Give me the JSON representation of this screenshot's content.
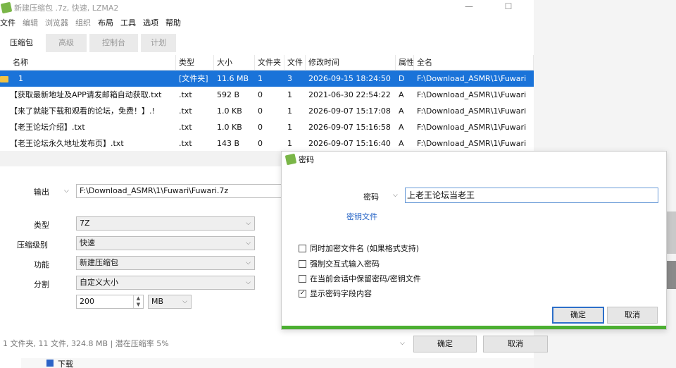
{
  "window": {
    "title": "新建压缩包 .7z, 快速, LZMA2",
    "minimize": "—",
    "maximize": "☐"
  },
  "menu": [
    "文件",
    "编辑",
    "浏览器",
    "组织",
    "布局",
    "工具",
    "选项",
    "帮助"
  ],
  "tabs": [
    "压缩包",
    "高级",
    "控制台",
    "计划"
  ],
  "table": {
    "headers": [
      "名称",
      "类型",
      "大小",
      "文件夹",
      "文件",
      "修改时间",
      "属性",
      "全名"
    ],
    "rows": [
      {
        "name": "1",
        "type": "[文件夹]",
        "size": "11.6 MB",
        "folders": "1",
        "files": "3",
        "modified": "2026-09-15 18:24:50",
        "attr": "D",
        "fullname": "F:\\Download_ASMR\\1\\Fuwari"
      },
      {
        "name": "【获取最新地址及APP请发邮箱自动获取.txt",
        "type": ".txt",
        "size": "592 B",
        "folders": "0",
        "files": "1",
        "modified": "2021-06-30 22:54:22",
        "attr": "A",
        "fullname": "F:\\Download_ASMR\\1\\Fuwari"
      },
      {
        "name": "【来了就能下载和观看的论坛，免费！】.!",
        "type": ".txt",
        "size": "1.0 KB",
        "folders": "0",
        "files": "1",
        "modified": "2026-09-07 15:17:08",
        "attr": "A",
        "fullname": "F:\\Download_ASMR\\1\\Fuwari"
      },
      {
        "name": "【老王论坛介绍】.txt",
        "type": ".txt",
        "size": "1.0 KB",
        "folders": "0",
        "files": "1",
        "modified": "2026-09-07 15:16:58",
        "attr": "A",
        "fullname": "F:\\Download_ASMR\\1\\Fuwari"
      },
      {
        "name": "【老王论坛永久地址发布页】.txt",
        "type": ".txt",
        "size": "143 B",
        "folders": "0",
        "files": "1",
        "modified": "2026-09-07 15:16:40",
        "attr": "A",
        "fullname": "F:\\Download_ASMR\\1\\Fuwari"
      }
    ]
  },
  "form": {
    "output_label": "输出",
    "output_value": "F:\\Download_ASMR\\1\\Fuwari\\Fuwari.7z",
    "type_label": "类型",
    "type_value": "7Z",
    "level_label": "压缩级别",
    "level_value": "快速",
    "function_label": "功能",
    "function_value": "新建压缩包",
    "split_label": "分割",
    "split_value": "自定义大小",
    "split_size": "200",
    "split_unit": "MB"
  },
  "status": {
    "text": "1 文件夹, 11 文件, 324.8 MB | 潜在压缩率 5%",
    "ok": "确定",
    "cancel": "取消",
    "download_label": "下载"
  },
  "dialog": {
    "title": "密码",
    "password_label": "密码",
    "password_value": "上老王论坛当老王",
    "keyfile_link": "密钥文件",
    "options": [
      {
        "label": "同时加密文件名 (如果格式支持)",
        "checked": false
      },
      {
        "label": "强制交互式输入密码",
        "checked": false
      },
      {
        "label": "在当前会话中保留密码/密钥文件",
        "checked": false
      },
      {
        "label": "显示密码字段内容",
        "checked": true
      }
    ],
    "ok": "确定",
    "cancel": "取消"
  },
  "colors": {
    "selection": "#1a73d9",
    "accent_green": "#4caf32",
    "link": "#1f5fc4"
  }
}
